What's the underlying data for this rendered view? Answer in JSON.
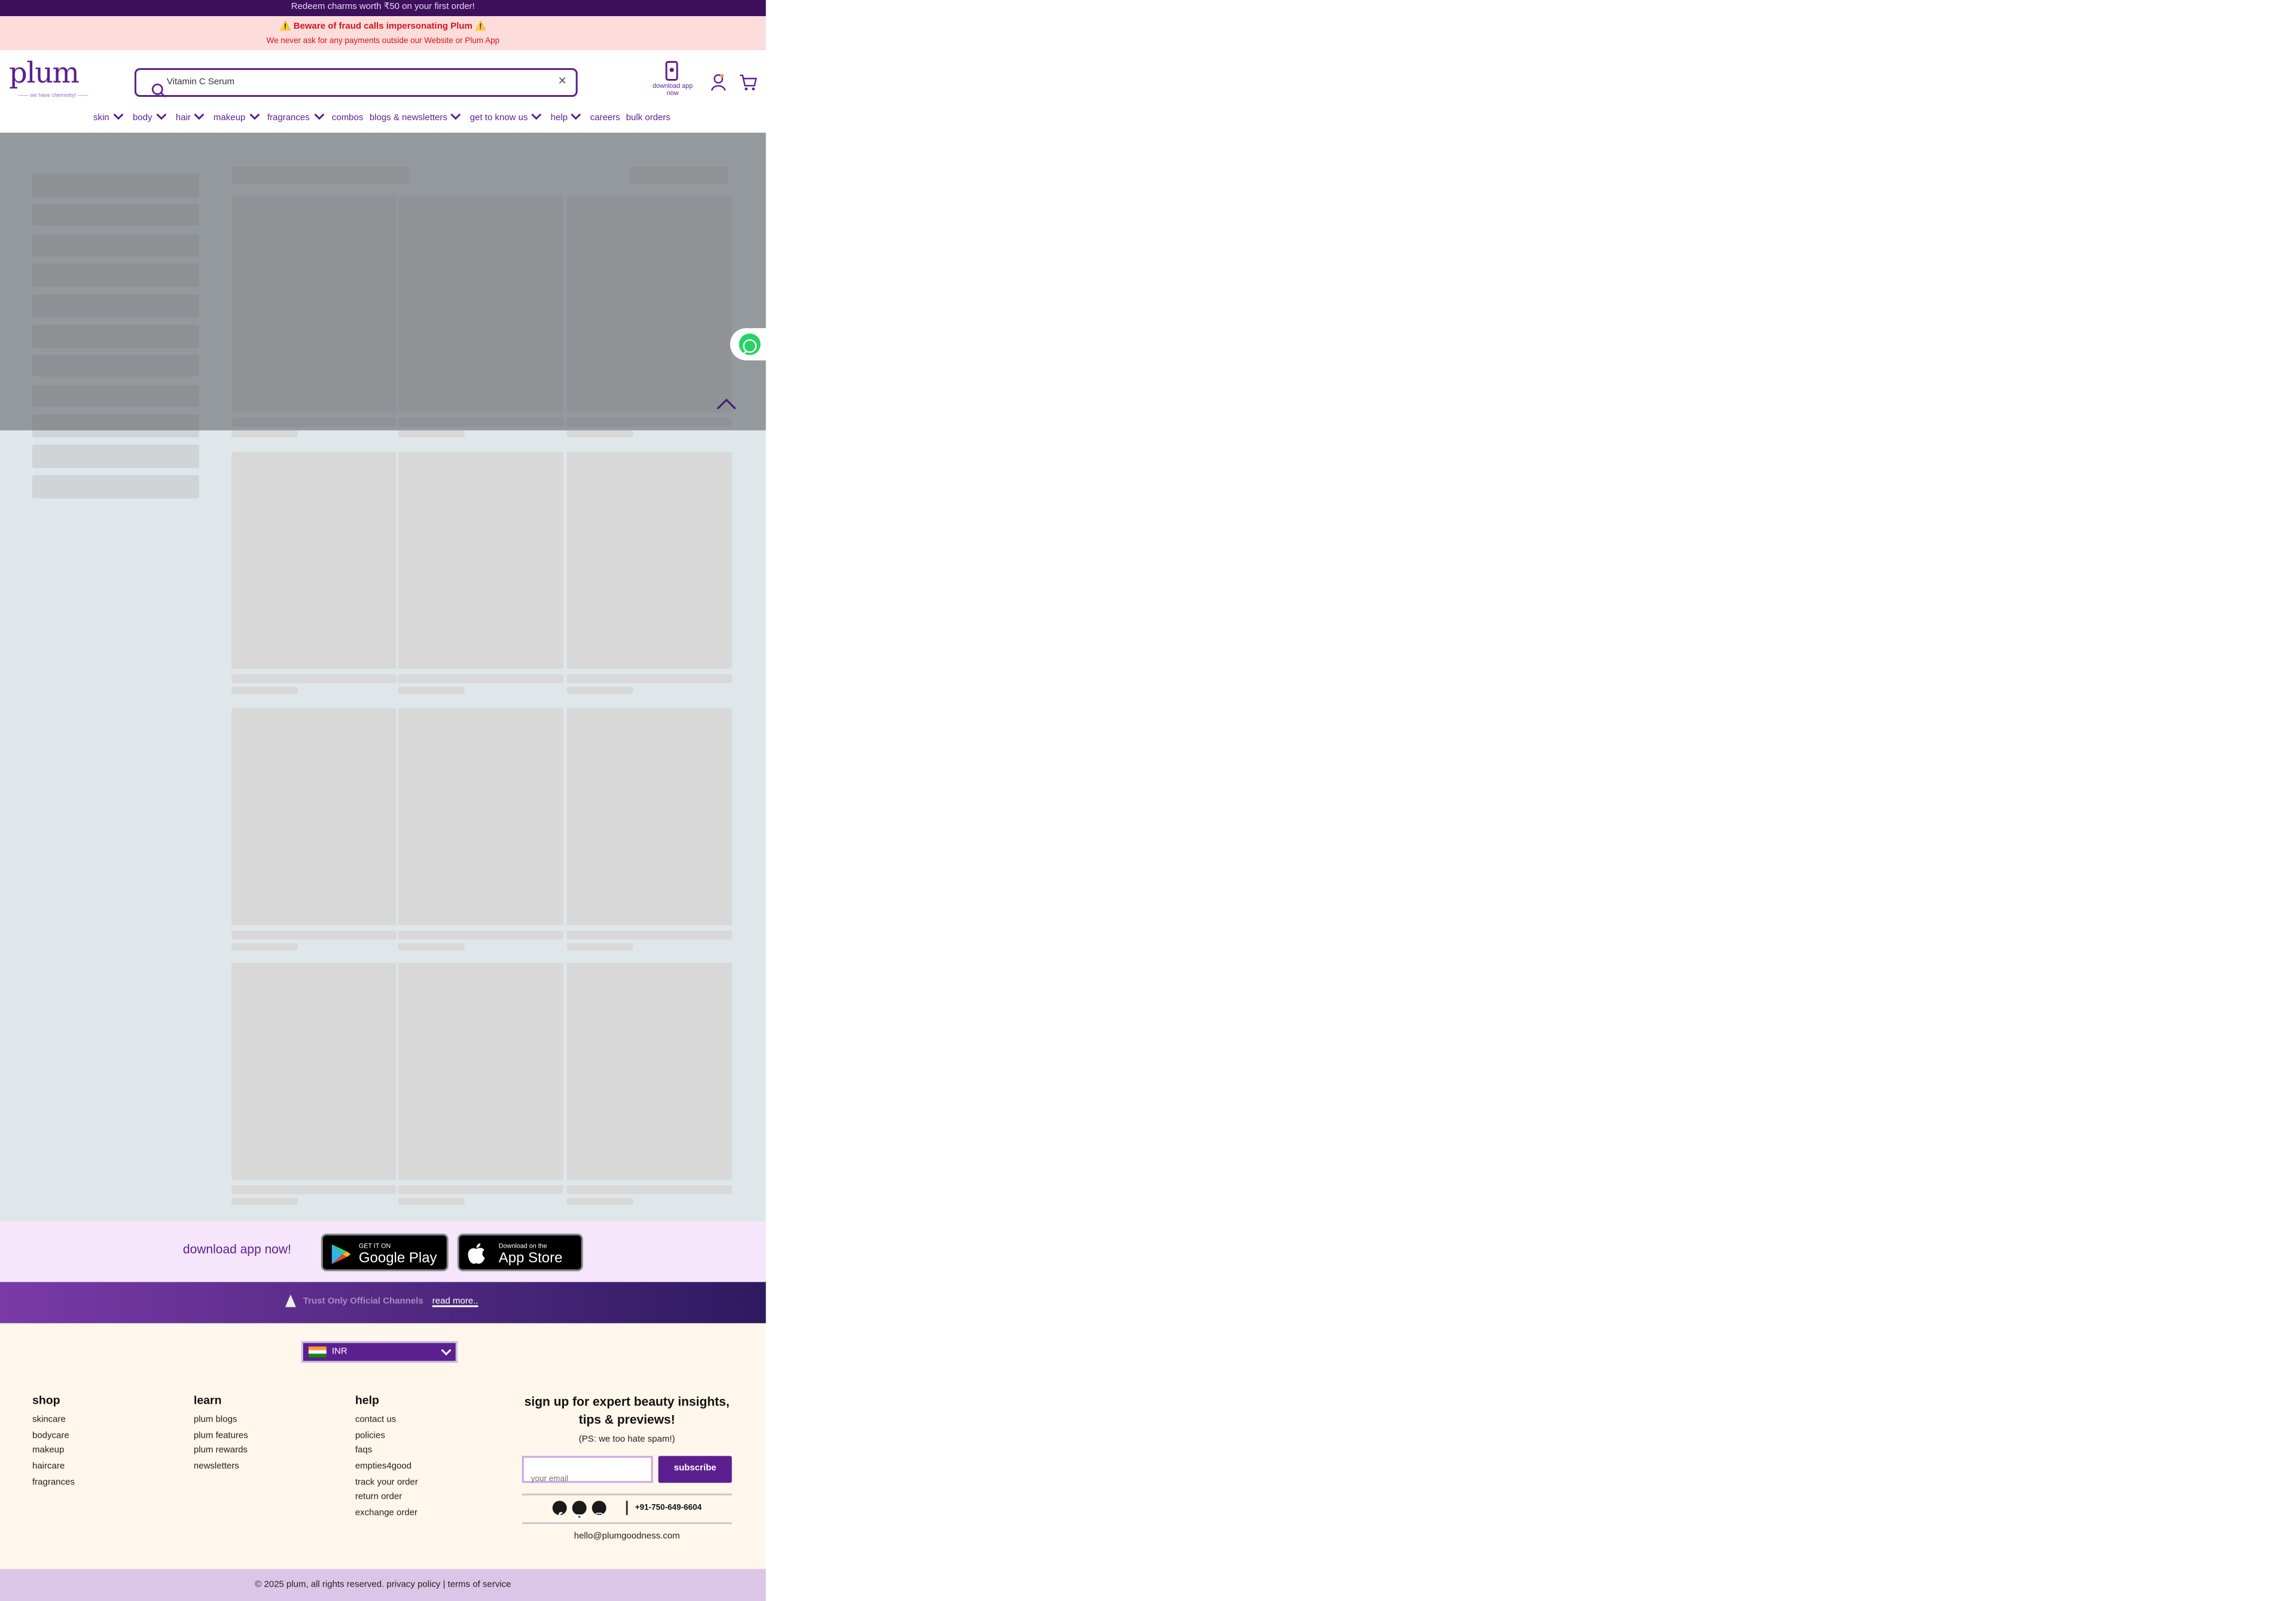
{
  "promo_bar": {
    "text": "Redeem charms worth ₹50 on your first order!"
  },
  "fraud_banner": {
    "title": "⚠️ Beware of fraud calls impersonating Plum ⚠️",
    "subtitle": "We never ask for any payments outside our Website or Plum App"
  },
  "header": {
    "logo": {
      "word": "plum",
      "tagline": "—— we have chemistry! ——"
    },
    "search": {
      "value": "Vitamin C Serum",
      "icon": "search-icon",
      "clear_icon": "close-icon"
    },
    "download_app": {
      "label": "download app now"
    },
    "icons": [
      "phone-icon",
      "account-icon",
      "cart-icon"
    ]
  },
  "nav": {
    "items": [
      {
        "label": "skin",
        "dropdown": true
      },
      {
        "label": "body",
        "dropdown": true
      },
      {
        "label": "hair",
        "dropdown": true
      },
      {
        "label": "makeup",
        "dropdown": true
      },
      {
        "label": "fragrances",
        "dropdown": true
      },
      {
        "label": "combos",
        "dropdown": false
      },
      {
        "label": "blogs & newsletters",
        "dropdown": true
      },
      {
        "label": "get to know us",
        "dropdown": true
      },
      {
        "label": "help",
        "dropdown": true
      },
      {
        "label": "careers",
        "dropdown": false
      },
      {
        "label": "bulk orders",
        "dropdown": false
      }
    ]
  },
  "main": {
    "state": "loading",
    "skeleton_filter_rows": 11,
    "skeleton_product_rows": 4,
    "skeleton_product_cols": 3
  },
  "floating": {
    "whatsapp_icon": "whatsapp-icon",
    "back_to_top_icon": "chevron-up-icon"
  },
  "app_band": {
    "text": "download app now!",
    "google_play": {
      "small": "GET IT ON",
      "large": "Google Play"
    },
    "app_store": {
      "small": "Download on the",
      "large": "App Store"
    }
  },
  "trust_banner": {
    "text": "Trust Only Official Channels",
    "link": "read more.."
  },
  "footer": {
    "currency": {
      "value": "INR"
    },
    "columns": [
      {
        "heading": "shop",
        "links": [
          "skincare",
          "bodycare",
          "makeup",
          "haircare",
          "fragrances"
        ]
      },
      {
        "heading": "learn",
        "links": [
          "plum blogs",
          "plum features",
          "plum rewards",
          "newsletters"
        ]
      },
      {
        "heading": "help",
        "links": [
          "contact us",
          "policies",
          "faqs",
          "empties4good",
          "track your order",
          "return order",
          "exchange order"
        ]
      }
    ],
    "newsletter": {
      "heading": "sign up for expert beauty insights, tips & previews!",
      "subheading": "(PS: we too hate spam!)",
      "email_placeholder": "your email",
      "button": "subscribe"
    },
    "social_icons": [
      "facebook-icon",
      "youtube-icon",
      "instagram-icon"
    ],
    "phone": "+91-750-649-6604",
    "email": "hello@plumgoodness.com"
  },
  "copyright": {
    "text": "© 2025 plum, all rights reserved. privacy policy | terms of service"
  },
  "colors": {
    "brand": "#5c1f8f",
    "promo_bg": "#3e0f5c",
    "fraud_text": "#d41616",
    "footer_bg": "#fff7ec"
  }
}
